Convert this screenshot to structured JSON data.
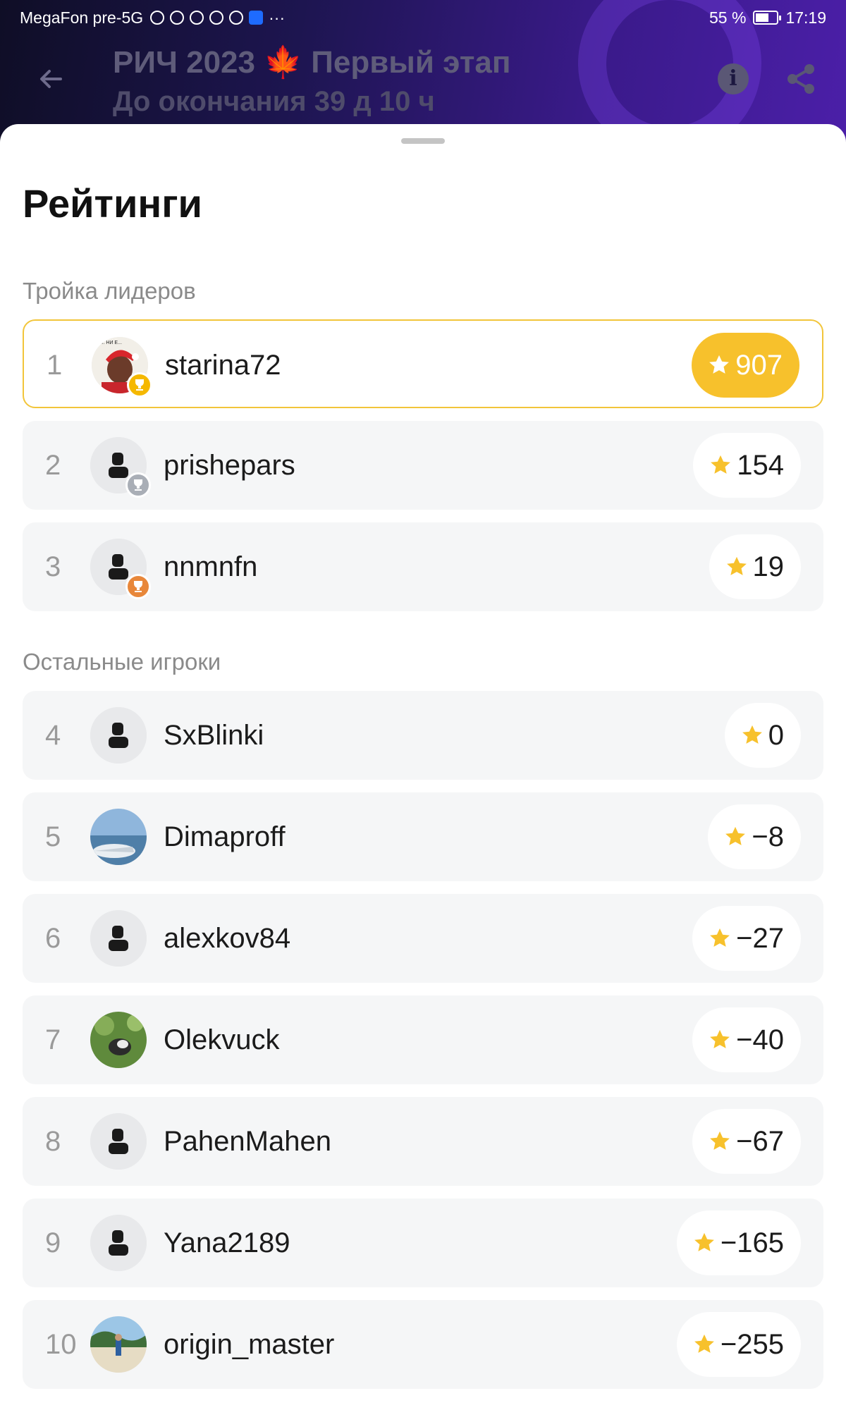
{
  "status": {
    "carrier": "MegaFon pre-5G",
    "battery": "55 %",
    "time": "17:19"
  },
  "appbar": {
    "title": "РИЧ 2023 🍁 Первый этап",
    "subtitle": "До окончания 39 д 10 ч"
  },
  "sheet": {
    "title": "Рейтинги",
    "leaders_label": "Тройка лидеров",
    "others_label": "Остальные игроки"
  },
  "leaders": [
    {
      "rank": "1",
      "name": "starina72",
      "score": "907",
      "trophy": "gold",
      "avatar": "photo-santa"
    },
    {
      "rank": "2",
      "name": "prishepars",
      "score": "154",
      "trophy": "silver",
      "avatar": "default"
    },
    {
      "rank": "3",
      "name": "nnmnfn",
      "score": "19",
      "trophy": "bronze",
      "avatar": "default"
    }
  ],
  "others": [
    {
      "rank": "4",
      "name": "SxBlinki",
      "score": "0",
      "avatar": "default"
    },
    {
      "rank": "5",
      "name": "Dimaproff",
      "score": "−8",
      "avatar": "photo-boat"
    },
    {
      "rank": "6",
      "name": "alexkov84",
      "score": "−27",
      "avatar": "default"
    },
    {
      "rank": "7",
      "name": "Olekvuck",
      "score": "−40",
      "avatar": "photo-raccoon"
    },
    {
      "rank": "8",
      "name": "PahenMahen",
      "score": "−67",
      "avatar": "default"
    },
    {
      "rank": "9",
      "name": "Yana2189",
      "score": "−165",
      "avatar": "default"
    },
    {
      "rank": "10",
      "name": "origin_master",
      "score": "−255",
      "avatar": "photo-beach"
    }
  ],
  "colors": {
    "accent": "#f7c12c",
    "gold": "#f5b800",
    "silver": "#a9aeb6",
    "bronze": "#e8873a"
  }
}
